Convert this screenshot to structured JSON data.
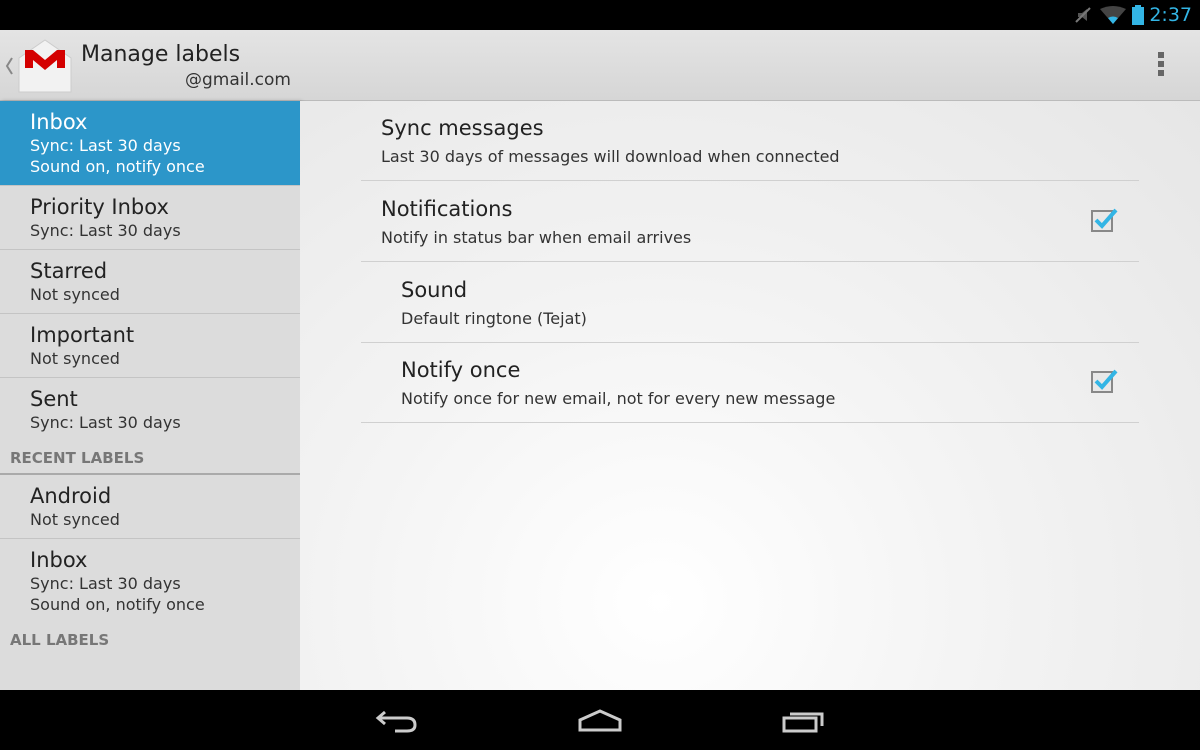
{
  "status_bar": {
    "time": "2:37",
    "icons": [
      "mute-icon",
      "wifi-icon",
      "battery-icon"
    ]
  },
  "action_bar": {
    "title": "Manage labels",
    "account": "@gmail.com",
    "icons": [
      "back-chevron-icon",
      "gmail-logo-icon",
      "overflow-menu-icon"
    ]
  },
  "sidebar": {
    "items": [
      {
        "name": "Inbox",
        "lines": [
          "Sync: Last 30 days",
          "Sound on, notify once"
        ],
        "selected": true
      },
      {
        "name": "Priority Inbox",
        "lines": [
          "Sync: Last 30 days"
        ]
      },
      {
        "name": "Starred",
        "lines": [
          "Not synced"
        ]
      },
      {
        "name": "Important",
        "lines": [
          "Not synced"
        ]
      },
      {
        "name": "Sent",
        "lines": [
          "Sync: Last 30 days"
        ]
      }
    ],
    "recent_header": "RECENT LABELS",
    "recent": [
      {
        "name": "Android",
        "lines": [
          "Not synced"
        ]
      },
      {
        "name": "Inbox",
        "lines": [
          "Sync: Last 30 days",
          "Sound on, notify once"
        ]
      }
    ],
    "all_header": "ALL LABELS"
  },
  "settings": [
    {
      "title": "Sync messages",
      "desc": "Last 30 days of messages will download when connected"
    },
    {
      "title": "Notifications",
      "desc": "Notify in status bar when email arrives",
      "checked": true
    },
    {
      "title": "Sound",
      "desc": "Default ringtone (Tejat)"
    },
    {
      "title": "Notify once",
      "desc": "Notify once for new email, not for every new message",
      "checked": true
    }
  ],
  "colors": {
    "accent": "#33b5e5",
    "selected": "#2c96c9"
  }
}
